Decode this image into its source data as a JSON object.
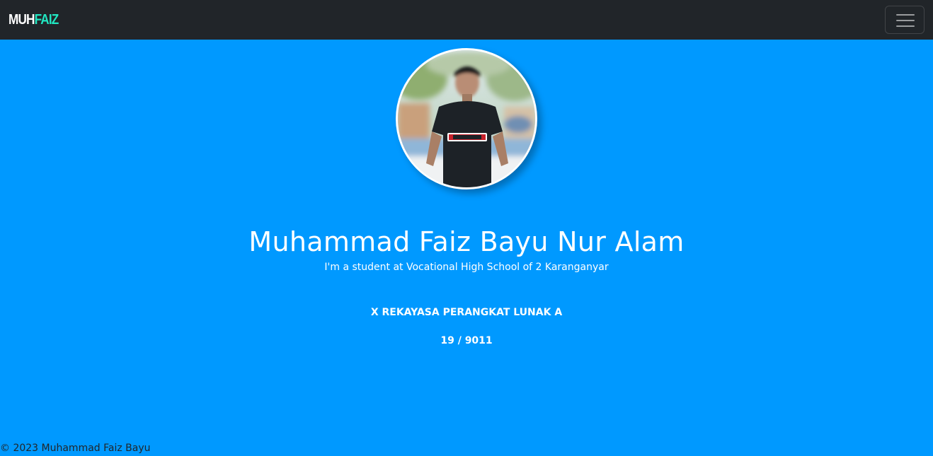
{
  "navbar": {
    "brand_first": "MUH",
    "brand_second": "FAIZ",
    "toggler_icon": "hamburger-menu-icon",
    "background": "#212529",
    "brand_accent": "#21e6c1"
  },
  "profile": {
    "photo_icon": "profile-photo",
    "name": "Muhammad Faiz Bayu Nur Alam",
    "tagline": "I'm a student at Vocational High School of 2 Karanganyar",
    "class_name": "X REKAYASA PERANGKAT LUNAK A",
    "student_number": "19 / 9011",
    "background": "#0099ff"
  },
  "footer": {
    "copyright": "© 2023 Muhammad Faiz Bayu"
  }
}
